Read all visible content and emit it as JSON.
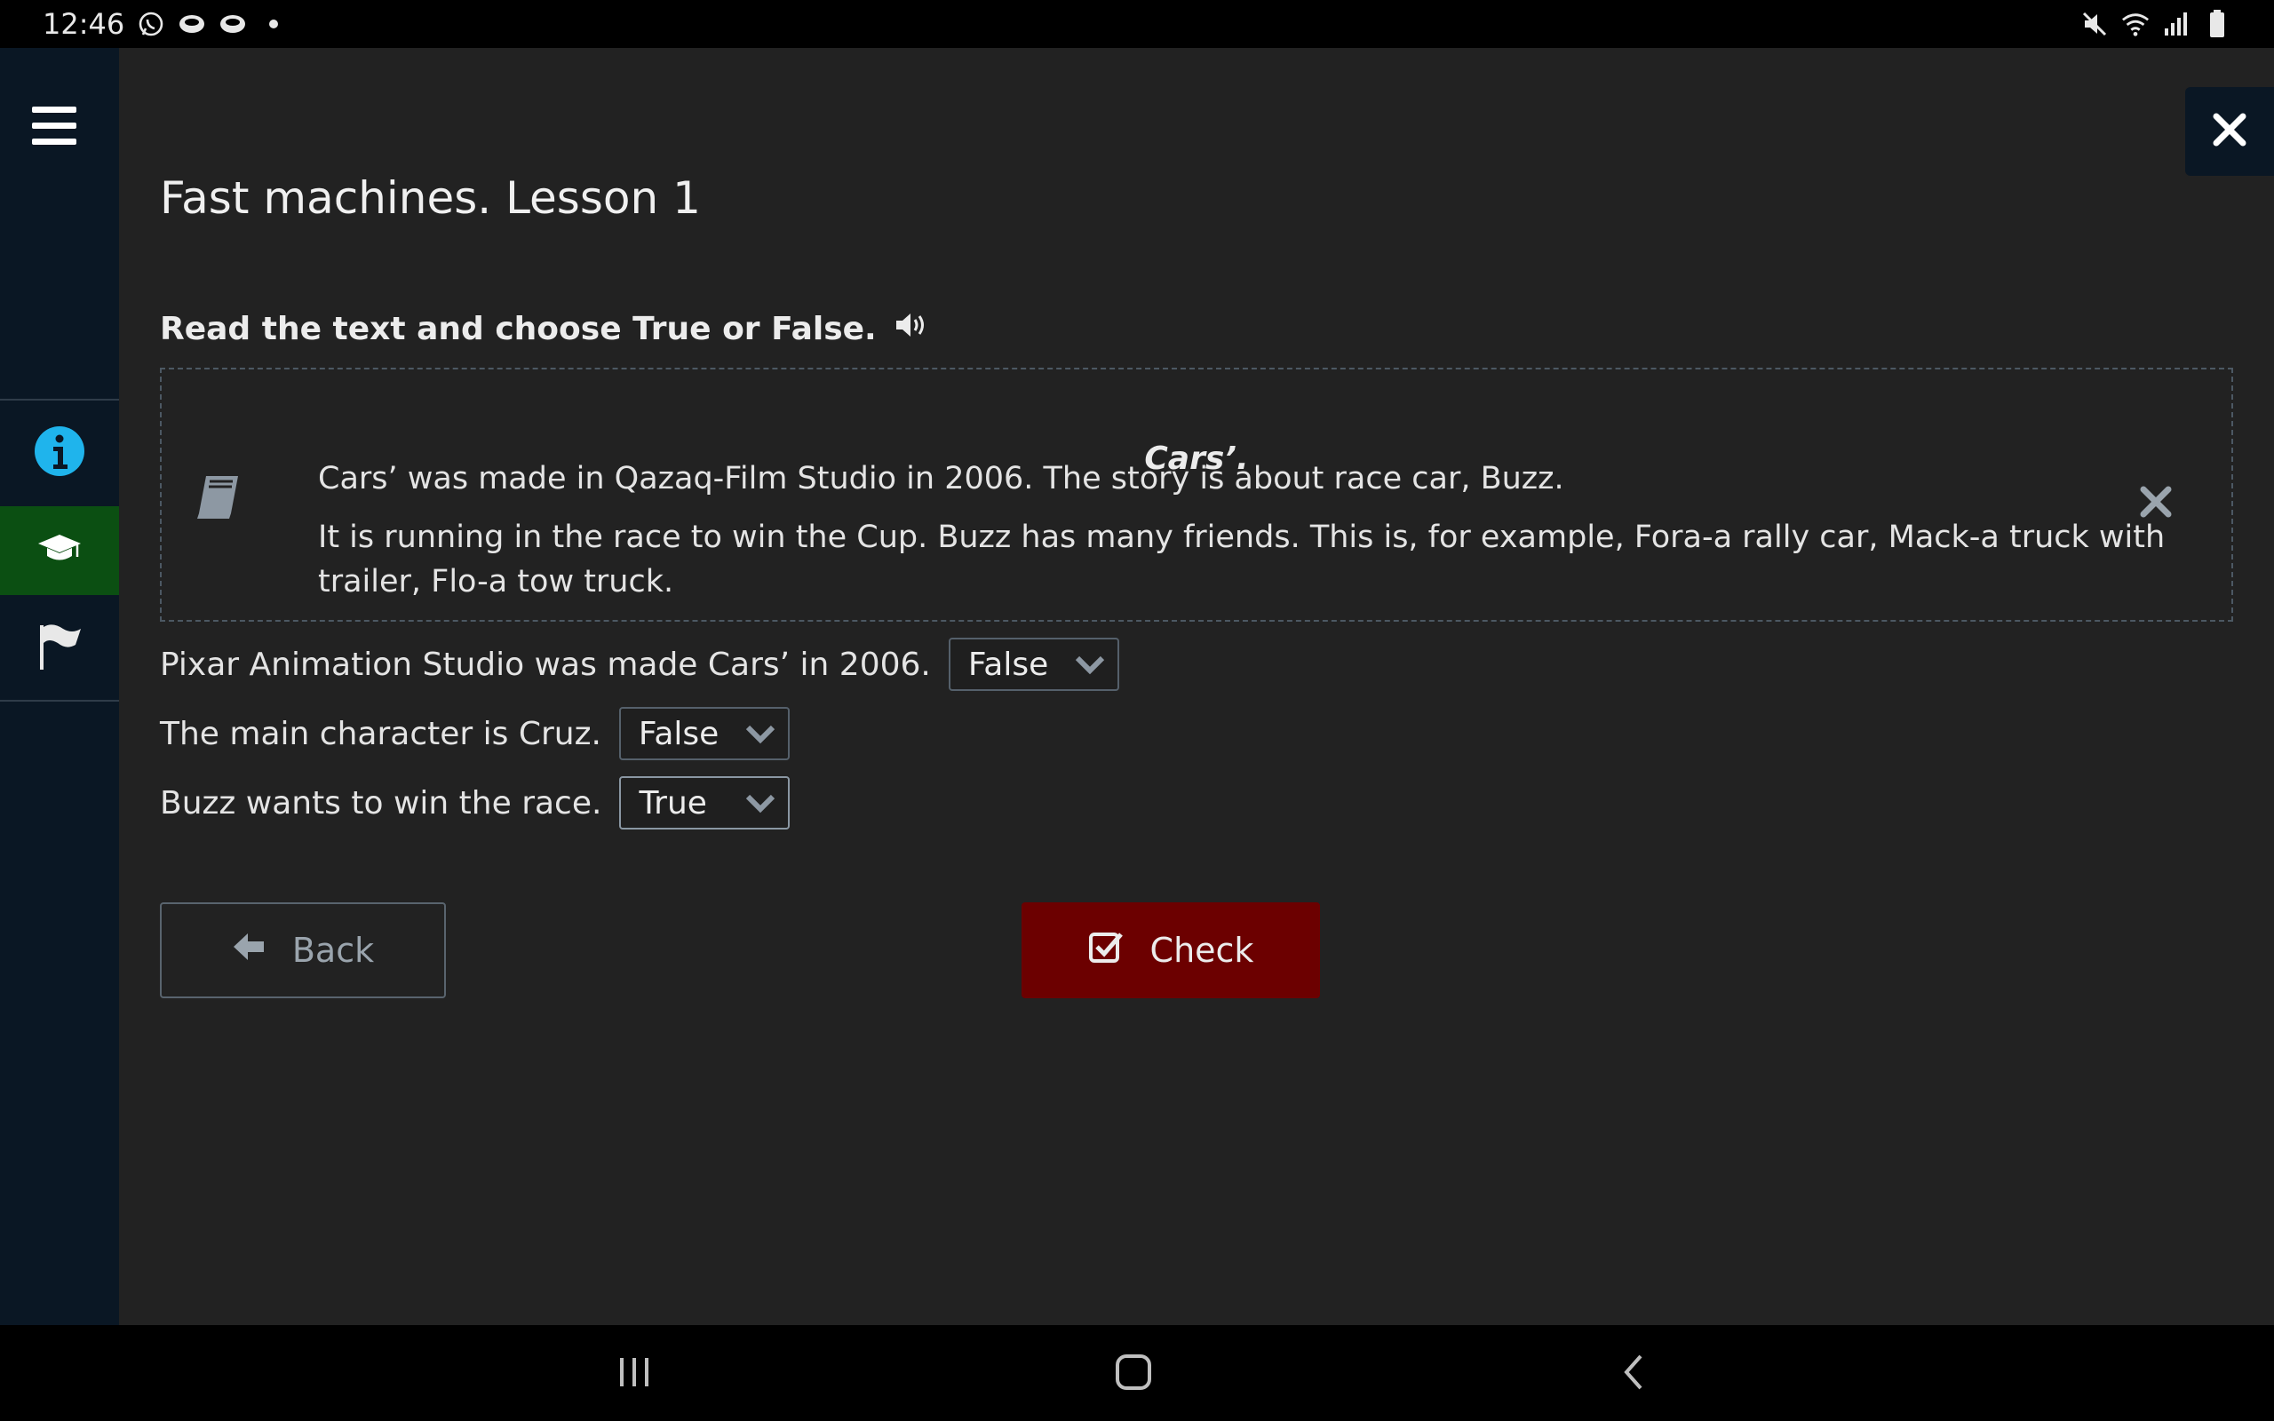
{
  "status_bar": {
    "time": "12:46"
  },
  "sidebar": {
    "items": [
      {
        "name": "info"
      },
      {
        "name": "lessons",
        "active": true
      },
      {
        "name": "flag"
      }
    ]
  },
  "page": {
    "title": "Fast machines. Lesson 1",
    "instruction": "Read the text and choose True or False."
  },
  "text_box": {
    "title": "Cars’.",
    "paragraphs": [
      "Cars’ was made in Qazaq-Film Studio in 2006. The story is about race car, Buzz.",
      "It is running in the race to win the Cup. Buzz has many friends. This is, for example, Fora-a rally car, Mack-a truck with trailer, Flo-a tow truck."
    ]
  },
  "questions": [
    {
      "text": "Pixar Animation Studio was made Cars’ in 2006.",
      "answer": "False"
    },
    {
      "text": "The main character is Cruz.",
      "answer": "False"
    },
    {
      "text": "Buzz wants to win the race.",
      "answer": "True"
    }
  ],
  "buttons": {
    "back": "Back",
    "check": "Check"
  },
  "colors": {
    "background": "#222222",
    "sidebar": "#0a1724",
    "active_item": "#0b4f12",
    "check_button": "#6c0000",
    "info_icon": "#1fb4ec"
  }
}
